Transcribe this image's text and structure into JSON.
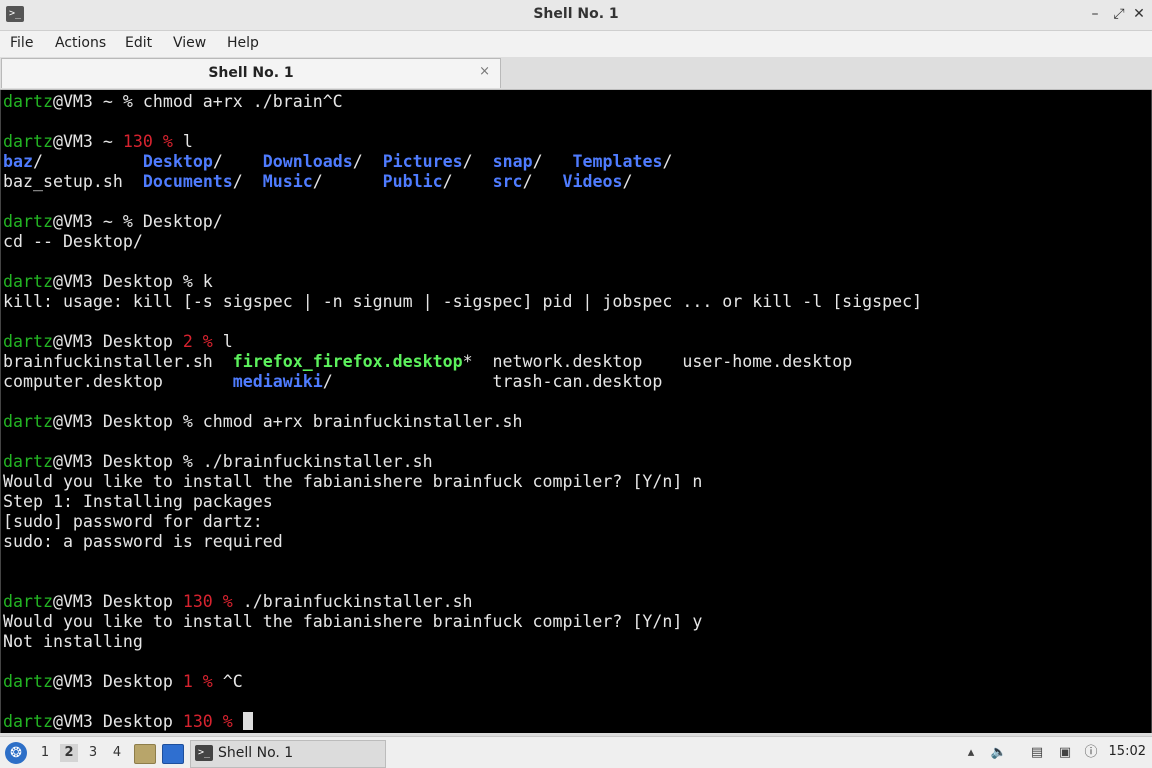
{
  "window": {
    "title": "Shell No. 1",
    "icon": "terminal-icon"
  },
  "menu": [
    "File",
    "Actions",
    "Edit",
    "View",
    "Help"
  ],
  "tab": {
    "label": "Shell No. 1",
    "close_glyph": "×"
  },
  "terminal_lines": [
    [
      [
        "g",
        "dartz"
      ],
      [
        "",
        "@VM3 ~ % chmod a+rx ./brain^C"
      ]
    ],
    [],
    [
      [
        "g",
        "dartz"
      ],
      [
        "",
        "@VM3 ~ "
      ],
      [
        "r",
        "130 %"
      ],
      [
        "",
        " l"
      ]
    ],
    [
      [
        "b",
        "baz"
      ],
      [
        "",
        "/          "
      ],
      [
        "b",
        "Desktop"
      ],
      [
        "",
        "/    "
      ],
      [
        "b",
        "Downloads"
      ],
      [
        "",
        "/  "
      ],
      [
        "b",
        "Pictures"
      ],
      [
        "",
        "/  "
      ],
      [
        "b",
        "snap"
      ],
      [
        "",
        "/   "
      ],
      [
        "b",
        "Templates"
      ],
      [
        "",
        "/"
      ]
    ],
    [
      [
        "",
        "baz_setup.sh  "
      ],
      [
        "b",
        "Documents"
      ],
      [
        "",
        "/  "
      ],
      [
        "b",
        "Music"
      ],
      [
        "",
        "/      "
      ],
      [
        "b",
        "Public"
      ],
      [
        "",
        "/    "
      ],
      [
        "b",
        "src"
      ],
      [
        "",
        "/   "
      ],
      [
        "b",
        "Videos"
      ],
      [
        "",
        "/"
      ]
    ],
    [],
    [
      [
        "g",
        "dartz"
      ],
      [
        "",
        "@VM3 ~ % Desktop/"
      ]
    ],
    [
      [
        "",
        "cd -- Desktop/"
      ]
    ],
    [],
    [
      [
        "g",
        "dartz"
      ],
      [
        "",
        "@VM3 Desktop % k"
      ]
    ],
    [
      [
        "",
        "kill: usage: kill [-s sigspec | -n signum | -sigspec] pid | jobspec ... or kill -l [sigspec]"
      ]
    ],
    [],
    [
      [
        "g",
        "dartz"
      ],
      [
        "",
        "@VM3 Desktop "
      ],
      [
        "r",
        "2 %"
      ],
      [
        "",
        " l"
      ]
    ],
    [
      [
        "",
        "brainfuckinstaller.sh  "
      ],
      [
        "e",
        "firefox_firefox.desktop"
      ],
      [
        "",
        "*  network.desktop    user-home.desktop"
      ]
    ],
    [
      [
        "",
        "computer.desktop       "
      ],
      [
        "b",
        "mediawiki"
      ],
      [
        "",
        "/                trash-can.desktop"
      ]
    ],
    [],
    [
      [
        "g",
        "dartz"
      ],
      [
        "",
        "@VM3 Desktop % chmod a+rx brainfuckinstaller.sh"
      ]
    ],
    [],
    [
      [
        "g",
        "dartz"
      ],
      [
        "",
        "@VM3 Desktop % ./brainfuckinstaller.sh"
      ]
    ],
    [
      [
        "",
        "Would you like to install the fabianishere brainfuck compiler? [Y/n] n"
      ]
    ],
    [
      [
        "",
        "Step 1: Installing packages"
      ]
    ],
    [
      [
        "",
        "[sudo] password for dartz:"
      ]
    ],
    [
      [
        "",
        "sudo: a password is required"
      ]
    ],
    [],
    [],
    [
      [
        "g",
        "dartz"
      ],
      [
        "",
        "@VM3 Desktop "
      ],
      [
        "r",
        "130 %"
      ],
      [
        "",
        " ./brainfuckinstaller.sh"
      ]
    ],
    [
      [
        "",
        "Would you like to install the fabianishere brainfuck compiler? [Y/n] y"
      ]
    ],
    [
      [
        "",
        "Not installing"
      ]
    ],
    [],
    [
      [
        "g",
        "dartz"
      ],
      [
        "",
        "@VM3 Desktop "
      ],
      [
        "r",
        "1 %"
      ],
      [
        "",
        " ^C"
      ]
    ],
    [],
    [
      [
        "g",
        "dartz"
      ],
      [
        "",
        "@VM3 Desktop "
      ],
      [
        "r",
        "130 %"
      ],
      [
        "",
        " "
      ],
      [
        "cursor",
        ""
      ]
    ]
  ],
  "taskbar": {
    "workspaces": [
      "1",
      "2",
      "3",
      "4"
    ],
    "active_workspace": "2",
    "task_label": "Shell No. 1",
    "clock": "15:02",
    "icons": [
      "start-menu-icon",
      "file-manager-icon",
      "desktop-icon",
      "terminal-icon",
      "tray-up-icon",
      "volume-icon",
      "clipboard-icon",
      "network-icon",
      "notification-icon"
    ]
  }
}
